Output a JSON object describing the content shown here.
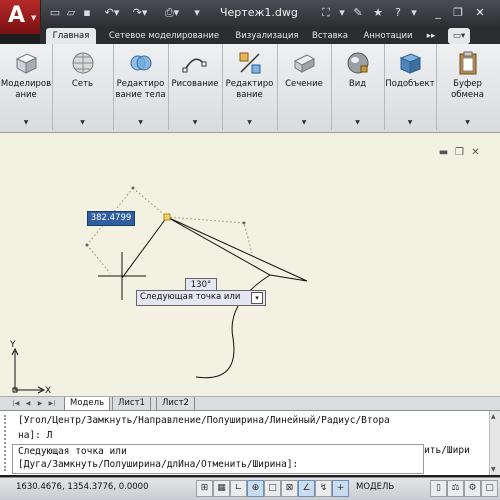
{
  "title_bar": {
    "document_title": "Чертеж1.dwg",
    "app_icon": "autocad-a-icon",
    "quick_access": [
      "new-icon",
      "open-icon",
      "save-icon",
      "undo-icon",
      "redo-icon",
      "plot-icon"
    ],
    "right_tools": [
      "binoculars-icon",
      "wrench-icon",
      "star-icon",
      "help-icon"
    ]
  },
  "tabs": [
    "Главная",
    "Сетевое моделирование",
    "Визуализация",
    "Вставка",
    "Аннотации"
  ],
  "tabs_active": "Главная",
  "ribbon": {
    "panels": [
      {
        "label_lines": [
          "Моделиров",
          "ание"
        ],
        "icon": "box-modeling-icon"
      },
      {
        "label_lines": [
          "Сеть"
        ],
        "icon": "mesh-icon"
      },
      {
        "label_lines": [
          "Редактиро",
          "вание тела"
        ],
        "icon": "solid-edit-icon"
      },
      {
        "label_lines": [
          "Рисование"
        ],
        "icon": "draw-icon"
      },
      {
        "label_lines": [
          "Редактиро",
          "вание"
        ],
        "icon": "modify-icon"
      },
      {
        "label_lines": [
          "Сечение"
        ],
        "icon": "section-icon"
      },
      {
        "label_lines": [
          "Вид"
        ],
        "icon": "view-icon"
      },
      {
        "label_lines": [
          "Подобъект"
        ],
        "icon": "subobject-icon"
      },
      {
        "label_lines": [
          "Буфер",
          "обмена"
        ],
        "icon": "clipboard-icon"
      }
    ]
  },
  "canvas": {
    "length_tooltip": "382.4799",
    "angle_tooltip": "130°",
    "prompt_tooltip": "Следующая точка или",
    "ucs_x": "X",
    "ucs_y": "Y"
  },
  "layout_tabs": [
    "Модель",
    "Лист1",
    "Лист2"
  ],
  "command_line": {
    "history_1": "[Угол/Центр/Замкнуть/Направление/Полуширина/Линейный/Радиус/Втора",
    "history_2": "на]: Л",
    "current_1": "Следующая точка или",
    "current_2": "[Дуга/Замкнуть/Полуширина/длИна/Отменить/Ширина]:",
    "overflow_text": "ить/Шири"
  },
  "status_bar": {
    "coordinates": "1630.4676, 1354.3776, 0.0000",
    "model_label": "МОДЕЛЬ"
  }
}
